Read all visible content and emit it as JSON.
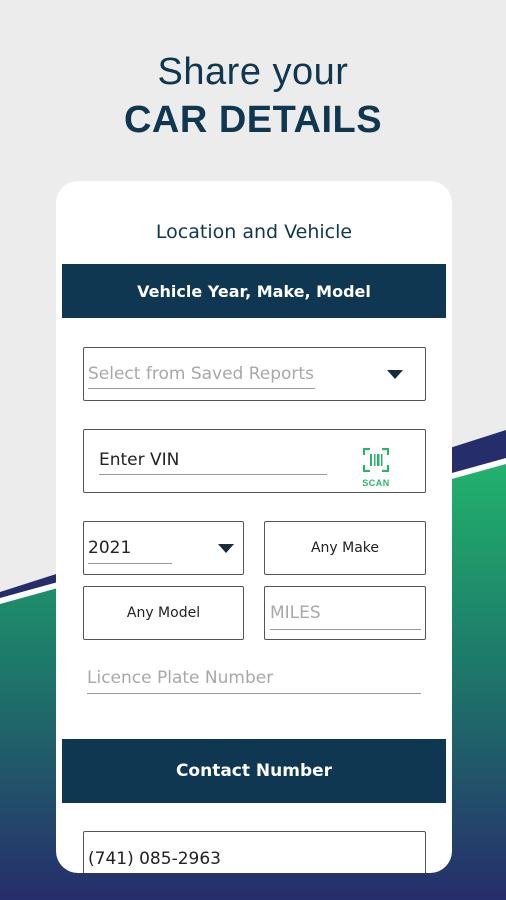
{
  "hero": {
    "line1": "Share your",
    "line2": "CAR DETAILS"
  },
  "card": {
    "title": "Location and Vehicle",
    "section_vehicle": "Vehicle Year, Make, Model",
    "saved_reports_placeholder": "Select from Saved Reports",
    "vin_placeholder": "Enter VIN",
    "scan_label": "SCAN",
    "year_value": "2021",
    "make_label": "Any Make",
    "model_label": "Any Model",
    "miles_placeholder": "MILES",
    "plate_placeholder": "Licence Plate Number",
    "section_contact": "Contact Number",
    "phone_value": "(741) 085-2963"
  },
  "colors": {
    "navy": "#0f3752",
    "green": "#2ab36b",
    "background": "#ececec"
  },
  "icons": {
    "scan": "barcode-scan-icon",
    "dropdown": "caret-down-icon"
  }
}
